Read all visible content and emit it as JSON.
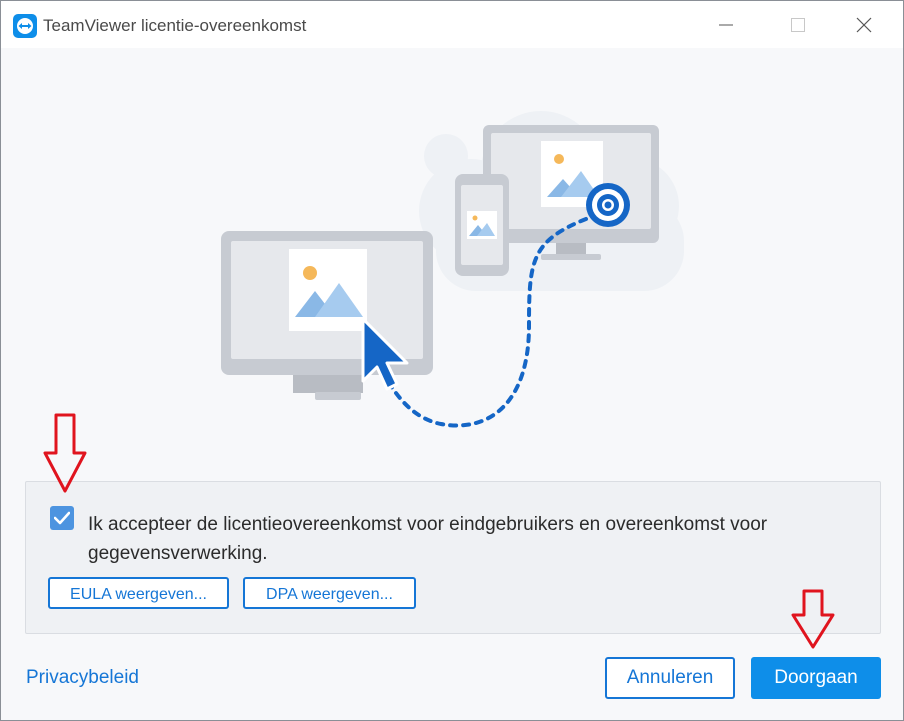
{
  "window": {
    "title": "TeamViewer licentie-overeenkomst",
    "icon": "teamviewer-logo-icon",
    "controls": [
      "minimize-icon",
      "maximize-icon",
      "close-icon"
    ]
  },
  "agreement": {
    "checked": true,
    "text": "Ik accepteer de licentieovereenkomst voor eindgebruikers en overeenkomst voor gegevensverwerking.",
    "eula_button": "EULA weergeven...",
    "dpa_button": "DPA weergeven..."
  },
  "footer": {
    "privacy_link": "Privacybeleid",
    "cancel_button": "Annuleren",
    "continue_button": "Doorgaan"
  },
  "colors": {
    "accent": "#1576d6",
    "primary_button": "#0e8ee9",
    "checkbox": "#4d94e0",
    "annotation_arrow": "#e0141e"
  }
}
